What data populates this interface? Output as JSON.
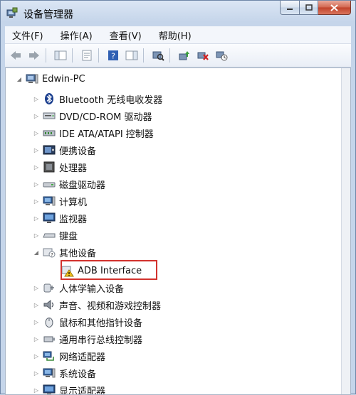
{
  "window": {
    "title": "设备管理器"
  },
  "menu": {
    "items": [
      "文件(F)",
      "操作(A)",
      "查看(V)",
      "帮助(H)"
    ]
  },
  "tree": {
    "root": "Edwin-PC",
    "categories": [
      "Bluetooth 无线电收发器",
      "DVD/CD-ROM 驱动器",
      "IDE ATA/ATAPI 控制器",
      "便携设备",
      "处理器",
      "磁盘驱动器",
      "计算机",
      "监视器",
      "键盘",
      "其他设备",
      "人体学输入设备",
      "声音、视频和游戏控制器",
      "鼠标和其他指针设备",
      "通用串行总线控制器",
      "网络适配器",
      "系统设备",
      "显示适配器"
    ],
    "other_child": "ADB Interface"
  }
}
